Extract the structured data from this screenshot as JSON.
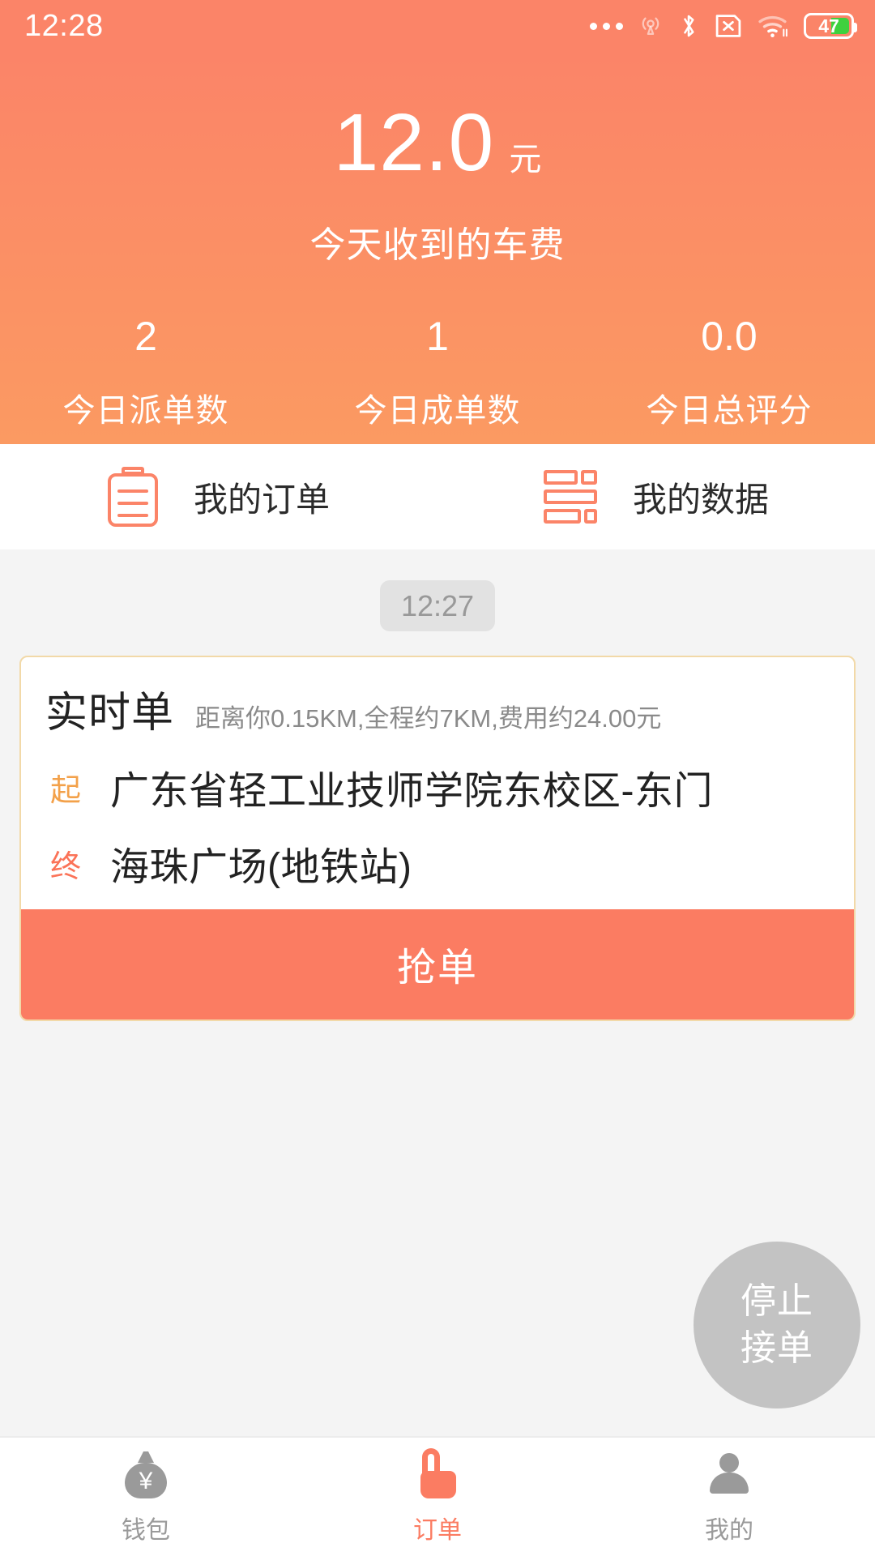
{
  "status_bar": {
    "time": "12:28",
    "battery_percent": "47",
    "icons": [
      "more-dots-icon",
      "hotspot-icon",
      "bluetooth-icon",
      "sim-card-off-icon",
      "wifi-icon",
      "battery-icon"
    ]
  },
  "header": {
    "amount": "12.0",
    "amount_unit": "元",
    "amount_caption": "今天收到的车费",
    "stats": [
      {
        "value": "2",
        "label": "今日派单数"
      },
      {
        "value": "1",
        "label": "今日成单数"
      },
      {
        "value": "0.0",
        "label": "今日总评分"
      }
    ]
  },
  "quick_menu": [
    {
      "label": "我的订单",
      "icon": "clipboard-icon"
    },
    {
      "label": "我的数据",
      "icon": "bars-icon"
    }
  ],
  "feed": {
    "timestamp": "12:27",
    "order_card": {
      "title": "实时单",
      "subtitle": "距离你0.15KM,全程约7KM,费用约24.00元",
      "start_tag": "起",
      "start_address": "广东省轻工业技师学院东校区-东门",
      "end_tag": "终",
      "end_address": "海珠广场(地铁站)",
      "action_label": "抢单"
    }
  },
  "fab": {
    "line1": "停止",
    "line2": "接单"
  },
  "tabbar": [
    {
      "label": "钱包",
      "icon": "wallet-icon",
      "active": false
    },
    {
      "label": "订单",
      "icon": "thumb-icon",
      "active": true
    },
    {
      "label": "我的",
      "icon": "person-icon",
      "active": false
    }
  ],
  "colors": {
    "brand_coral": "#fb8468",
    "brand_orange": "#fb9a62",
    "accent_button": "#fb7c62",
    "start_tag": "#f3a14a",
    "end_tag": "#fb7358",
    "muted": "#9a9a9a",
    "battery_green": "#3ed13e"
  }
}
